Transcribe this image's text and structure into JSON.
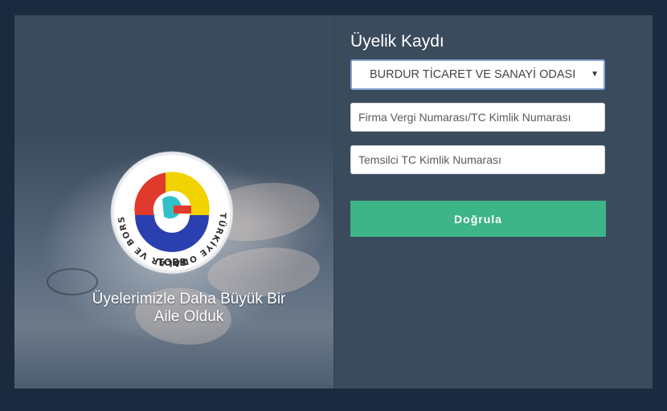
{
  "branding": {
    "logo_ring_text": "TÜRKİYE ODALAR VE BORSALAR BİRLİĞİ",
    "logo_abbr": "TOBB",
    "slogan_line1": "Üyelerimizle Daha Büyük Bir",
    "slogan_line2": "Aile Olduk"
  },
  "form": {
    "title": "Üyelik Kaydı",
    "chamber_select_value": "BURDUR TİCARET VE SANAYİ ODASI",
    "tax_id_placeholder": "Firma Vergi Numarası/TC Kimlik Numarası",
    "rep_id_placeholder": "Temsilci TC Kimlik Numarası",
    "submit_label": "Doğrula"
  },
  "colors": {
    "page_bg": "#1b2a3f",
    "card_bg": "#3a4b5c",
    "button_bg": "#3eb489",
    "logo_red": "#e03a2c",
    "logo_yellow": "#f2d200",
    "logo_blue": "#2a3fb0",
    "logo_cyan": "#33c1c9"
  },
  "icons": {
    "select_caret": "caret-down-icon"
  }
}
